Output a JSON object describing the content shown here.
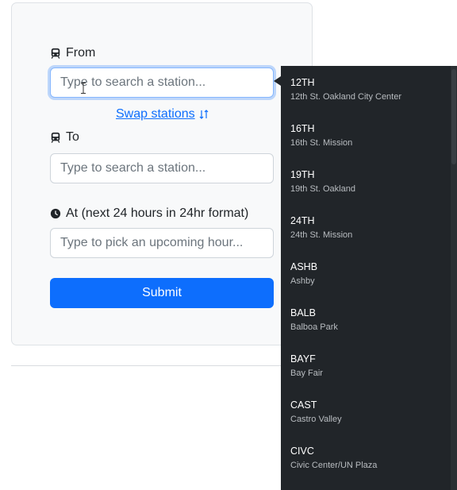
{
  "form": {
    "from_label": "From",
    "from_placeholder": "Type to search a station...",
    "swap_label": "Swap stations",
    "to_label": "To",
    "to_placeholder": "Type to search a station...",
    "time_label": "At (next 24 hours in 24hr format)",
    "time_placeholder": "Type to pick an upcoming hour...",
    "submit_label": "Submit"
  },
  "dropdown": {
    "items": [
      {
        "code": "12TH",
        "name": "12th St. Oakland City Center"
      },
      {
        "code": "16TH",
        "name": "16th St. Mission"
      },
      {
        "code": "19TH",
        "name": "19th St. Oakland"
      },
      {
        "code": "24TH",
        "name": "24th St. Mission"
      },
      {
        "code": "ASHB",
        "name": "Ashby"
      },
      {
        "code": "BALB",
        "name": "Balboa Park"
      },
      {
        "code": "BAYF",
        "name": "Bay Fair"
      },
      {
        "code": "CAST",
        "name": "Castro Valley"
      },
      {
        "code": "CIVC",
        "name": "Civic Center/UN Plaza"
      }
    ]
  },
  "colors": {
    "primary": "#0d6efd",
    "dropdown_bg": "#212529",
    "card_bg": "#f8f9fa"
  },
  "icons": [
    "train-icon",
    "swap-arrows-icon",
    "clock-icon",
    "text-cursor-icon"
  ]
}
